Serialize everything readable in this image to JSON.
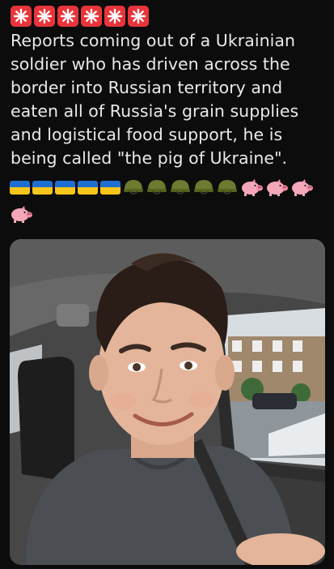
{
  "tweet": {
    "siren_icons": [
      "siren-icon",
      "siren-icon",
      "siren-icon",
      "siren-icon",
      "siren-icon",
      "siren-icon"
    ],
    "text_lines": [
      "Reports coming out of a Ukrainian",
      "soldier who has driven across the",
      "border into Russian territory and",
      "eaten all of Russia's grain supplies",
      "and logistical food support, he is",
      "being called \"the pig of Ukraine\"."
    ],
    "emoji_row": {
      "flags": 5,
      "helmets": 5,
      "pigs": 3
    },
    "emoji_row2": {
      "pigs": 1
    }
  },
  "colors": {
    "background": "#0c0c0c",
    "text": "#e9e9e9",
    "siren_bg": "#e8353b",
    "flag_blue": "#1f6fd1",
    "flag_yellow": "#f6c51b",
    "helmet": "#6b7b2f",
    "pig": "#f4a7b9"
  }
}
